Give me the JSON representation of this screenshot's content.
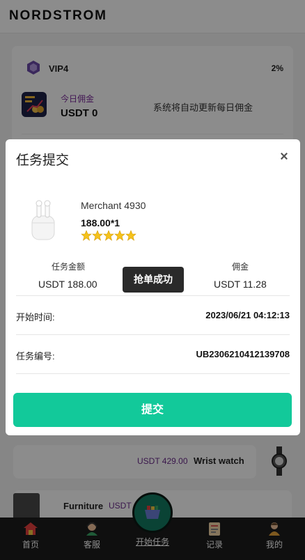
{
  "app": {
    "brand": "NORDSTROM"
  },
  "vip": {
    "level": "VIP4",
    "percent": "2%",
    "today_label": "今日佣金",
    "today_value": "USDT 0",
    "auto_note": "系统将自动更新每日佣金"
  },
  "background_orders": [
    {
      "name": "Wrist watch",
      "amount": "USDT 429.00"
    },
    {
      "name": "Furniture",
      "amount": "USDT"
    }
  ],
  "modal": {
    "title": "任务提交",
    "close_glyph": "×",
    "product": {
      "merchant": "Merchant 4930",
      "price_qty": "188.00*1",
      "rating_stars": 5
    },
    "task_amount_label": "任务金额",
    "task_amount_value": "USDT  188.00",
    "commission_label": "佣金",
    "commission_value": "USDT  11.28",
    "toast": "抢单成功",
    "start_time_label": "开始时间:",
    "start_time_value": "2023/06/21 04:12:13",
    "task_no_label": "任务编号:",
    "task_no_value": "UB2306210412139708",
    "submit_label": "提交"
  },
  "nav": {
    "items": [
      {
        "label": "首页",
        "icon": "home-icon"
      },
      {
        "label": "客服",
        "icon": "support-agent-icon"
      },
      {
        "label": "开始任务",
        "icon": "shopping-basket-icon"
      },
      {
        "label": "记录",
        "icon": "records-icon"
      },
      {
        "label": "我的",
        "icon": "profile-icon"
      }
    ]
  },
  "colors": {
    "accent": "#12c99a",
    "nav_bg": "#1c1c1c",
    "purple_text": "#6a2a8a"
  }
}
